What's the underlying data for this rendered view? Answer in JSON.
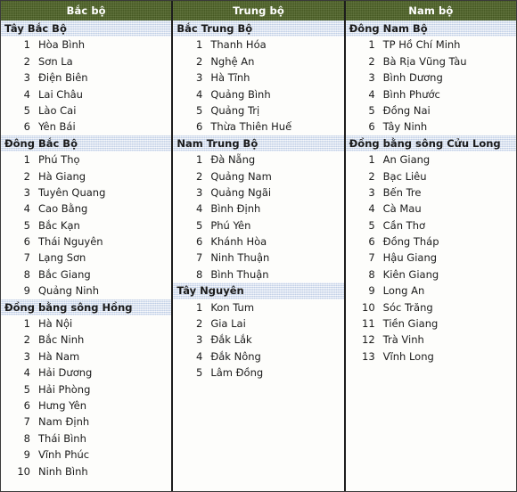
{
  "columns": [
    {
      "header": "Bắc bộ",
      "sections": [
        {
          "title": "Tây Bắc Bộ",
          "items": [
            {
              "num": "1",
              "name": "Hòa Bình"
            },
            {
              "num": "2",
              "name": "Sơn La"
            },
            {
              "num": "3",
              "name": "Điện Biên"
            },
            {
              "num": "4",
              "name": "Lai Châu"
            },
            {
              "num": "5",
              "name": "Lào Cai"
            },
            {
              "num": "6",
              "name": "Yên Bái"
            }
          ]
        },
        {
          "title": "Đông Bắc Bộ",
          "items": [
            {
              "num": "1",
              "name": "Phú Thọ"
            },
            {
              "num": "2",
              "name": "Hà Giang"
            },
            {
              "num": "3",
              "name": "Tuyên Quang"
            },
            {
              "num": "4",
              "name": "Cao Bằng"
            },
            {
              "num": "5",
              "name": "Bắc Kạn"
            },
            {
              "num": "6",
              "name": "Thái Nguyên"
            },
            {
              "num": "7",
              "name": "Lạng Sơn"
            },
            {
              "num": "8",
              "name": "Bắc Giang"
            },
            {
              "num": "9",
              "name": "Quảng Ninh"
            }
          ]
        },
        {
          "title": "Đồng bằng sông Hồng",
          "items": [
            {
              "num": "1",
              "name": "Hà Nội"
            },
            {
              "num": "2",
              "name": "Bắc Ninh"
            },
            {
              "num": "3",
              "name": "Hà Nam"
            },
            {
              "num": "4",
              "name": "Hải Dương"
            },
            {
              "num": "5",
              "name": "Hải Phòng"
            },
            {
              "num": "6",
              "name": "Hưng Yên"
            },
            {
              "num": "7",
              "name": "Nam Định"
            },
            {
              "num": "8",
              "name": "Thái Bình"
            },
            {
              "num": "9",
              "name": "Vĩnh Phúc"
            },
            {
              "num": "10",
              "name": "Ninh Bình"
            }
          ]
        }
      ]
    },
    {
      "header": "Trung bộ",
      "sections": [
        {
          "title": "Bắc Trung Bộ",
          "items": [
            {
              "num": "1",
              "name": "Thanh Hóa"
            },
            {
              "num": "2",
              "name": "Nghệ An"
            },
            {
              "num": "3",
              "name": "Hà Tĩnh"
            },
            {
              "num": "4",
              "name": "Quảng Bình"
            },
            {
              "num": "5",
              "name": "Quảng Trị"
            },
            {
              "num": "6",
              "name": "Thừa Thiên Huế"
            }
          ]
        },
        {
          "title": "Nam Trung Bộ",
          "items": [
            {
              "num": "1",
              "name": "Đà Nẵng"
            },
            {
              "num": "2",
              "name": "Quảng Nam"
            },
            {
              "num": "3",
              "name": "Quảng Ngãi"
            },
            {
              "num": "4",
              "name": "Bình Định"
            },
            {
              "num": "5",
              "name": "Phú Yên"
            },
            {
              "num": "6",
              "name": "Khánh Hòa"
            },
            {
              "num": "7",
              "name": "Ninh Thuận"
            },
            {
              "num": "8",
              "name": "Bình Thuận"
            }
          ]
        },
        {
          "title": "Tây Nguyên",
          "items": [
            {
              "num": "1",
              "name": "Kon Tum"
            },
            {
              "num": "2",
              "name": "Gia Lai"
            },
            {
              "num": "3",
              "name": "Đắk Lắk"
            },
            {
              "num": "4",
              "name": "Đắk Nông"
            },
            {
              "num": "5",
              "name": "Lâm Đồng"
            }
          ]
        }
      ]
    },
    {
      "header": "Nam bộ",
      "sections": [
        {
          "title": "Đông Nam Bộ",
          "items": [
            {
              "num": "1",
              "name": "TP Hồ Chí Minh"
            },
            {
              "num": "2",
              "name": "Bà Rịa Vũng Tàu"
            },
            {
              "num": "3",
              "name": "Bình Dương"
            },
            {
              "num": "4",
              "name": "Bình Phước"
            },
            {
              "num": "5",
              "name": "Đồng Nai"
            },
            {
              "num": "6",
              "name": "Tây Ninh"
            }
          ]
        },
        {
          "title": "Đồng bằng sông Cửu Long",
          "items": [
            {
              "num": "1",
              "name": "An Giang"
            },
            {
              "num": "2",
              "name": "Bạc Liêu"
            },
            {
              "num": "3",
              "name": "Bến Tre"
            },
            {
              "num": "4",
              "name": "Cà Mau"
            },
            {
              "num": "5",
              "name": "Cần Thơ"
            },
            {
              "num": "6",
              "name": "Đồng Tháp"
            },
            {
              "num": "7",
              "name": "Hậu Giang"
            },
            {
              "num": "8",
              "name": "Kiên Giang"
            },
            {
              "num": "9",
              "name": "Long An"
            },
            {
              "num": "10",
              "name": "Sóc Trăng"
            },
            {
              "num": "11",
              "name": "Tiền Giang"
            },
            {
              "num": "12",
              "name": "Trà Vinh"
            },
            {
              "num": "13",
              "name": "Vĩnh Long"
            }
          ]
        }
      ]
    }
  ],
  "colors": {
    "header_background": "#4d6225",
    "header_text": "#ffffff",
    "section_background": "#d9e2f0",
    "body_background": "#fdfdfb",
    "border": "#1d1d1d",
    "text": "#1b1b1b"
  }
}
